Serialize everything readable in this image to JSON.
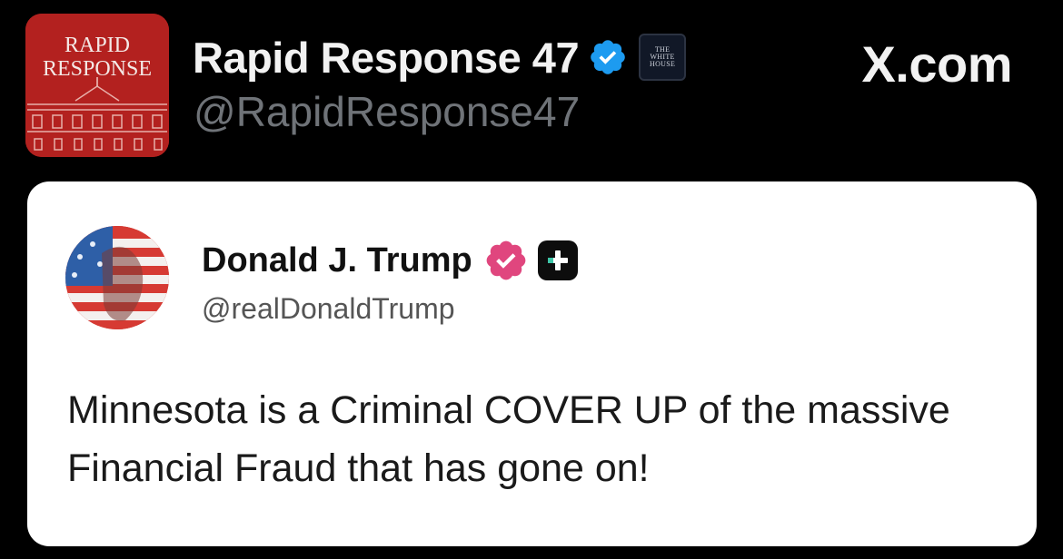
{
  "account": {
    "display_name": "Rapid Response 47",
    "handle": "@RapidResponse47",
    "avatar_text_line1": "RAPID",
    "avatar_text_line2": "RESPONSE",
    "verified_icon": "verified-badge-icon",
    "affiliation_badge_line1": "THE",
    "affiliation_badge_line2": "WHITE",
    "affiliation_badge_line3": "HOUSE"
  },
  "site": {
    "label": "X.com"
  },
  "quoted_post": {
    "display_name": "Donald J. Trump",
    "handle": "@realDonaldTrump",
    "text": "Minnesota is a Criminal COVER UP of the massive Financial Fraud that has gone on!",
    "verified_icon": "pink-verified-badge-icon",
    "extra_icon": "truth-social-plus-icon"
  },
  "colors": {
    "background": "#000000",
    "avatar_red": "#b3211f",
    "verified_blue": "#1d9bf0",
    "verified_pink": "#e0467e",
    "card": "#ffffff",
    "handle_gray": "#6f7378"
  }
}
